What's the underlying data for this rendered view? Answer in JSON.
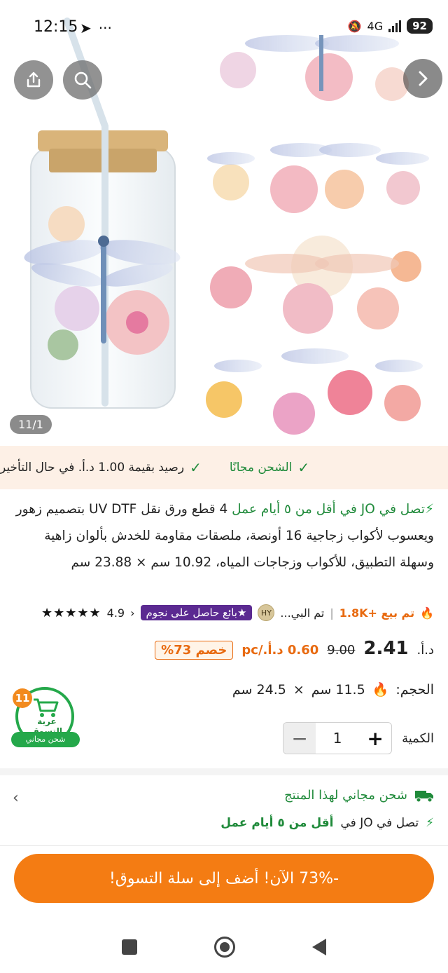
{
  "status_bar": {
    "time": "12:15",
    "battery": "92",
    "network": "4G"
  },
  "gallery": {
    "counter": "11/1"
  },
  "shipping_strip": {
    "free_shipping": "الشحن مجانًا",
    "credit": "رصيد بقيمة 1.00 د.أ. في حال التأخير"
  },
  "product": {
    "fast_delivery": "تصل في JO في أقل من ٥ أيام عمل",
    "title": "4 قطع ورق نقل UV DTF بتصميم زهور ويعسوب لأكواب زجاجية 16 أونصة، ملصقات مقاومة للخدش بألوان زاهية وسهلة التطبيق، للأكواب وزجاجات المياه، 10.92 سم × 23.88 سم"
  },
  "meta": {
    "sold": "تم بيع +1.8K",
    "seller": "تم البي...",
    "seller_avatar": "HY",
    "star_badge": "بائع حاصل على نجوم",
    "rating": "4.9",
    "stars": "★★★★★"
  },
  "price": {
    "currency": "د.أ.",
    "current": "2.41",
    "original": "9.00",
    "per_unit": "0.60 د.أ./pc",
    "discount": "خصم 73%"
  },
  "size": {
    "label": "الحجم:",
    "option_a": "11.5 سم",
    "times": "×",
    "option_b": "24.5 سم"
  },
  "quantity": {
    "label": "الكمية",
    "value": "1",
    "minus": "−",
    "plus": "+"
  },
  "cart": {
    "count": "11",
    "label": "عربة التسوق",
    "free": "شحن مجاني"
  },
  "free_shipping_box": {
    "title": "شحن مجاني لهذا المنتج",
    "delivery_prefix": "تصل في JO في",
    "delivery_bold": "أقل من ٥ أيام عمل"
  },
  "cta": {
    "label": "-73% الآن! أضف إلى سلة التسوق!"
  },
  "colors": {
    "accent": "#f47c13",
    "green": "#1f8a3a",
    "purple": "#5b2a91"
  }
}
